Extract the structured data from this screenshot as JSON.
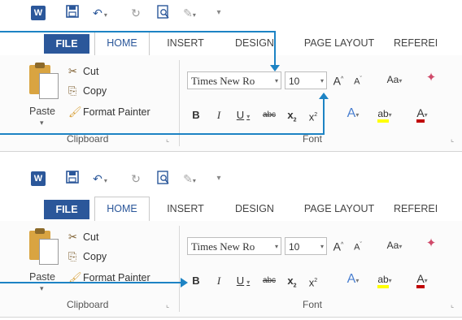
{
  "panels": [
    {
      "qat": {
        "redo": "↻",
        "customize": "▾"
      },
      "tabs": {
        "file": "FILE",
        "home": "HOME",
        "insert": "INSERT",
        "design": "DESIGN",
        "page_layout": "PAGE LAYOUT",
        "references": "REFEREI"
      },
      "clipboard": {
        "paste": "Paste",
        "cut": "Cut",
        "copy": "Copy",
        "format_painter": "Format Painter",
        "group_label": "Clipboard"
      },
      "font": {
        "name": "Times New Ro",
        "size": "10",
        "group_label": "Font"
      }
    },
    {
      "qat": {
        "redo": "↻",
        "customize": "▾"
      },
      "tabs": {
        "file": "FILE",
        "home": "HOME",
        "insert": "INSERT",
        "design": "DESIGN",
        "page_layout": "PAGE LAYOUT",
        "references": "REFEREI"
      },
      "clipboard": {
        "paste": "Paste",
        "cut": "Cut",
        "copy": "Copy",
        "format_painter": "Format Painter",
        "group_label": "Clipboard"
      },
      "font": {
        "name": "Times New Ro",
        "size": "10",
        "group_label": "Font"
      }
    }
  ],
  "colors": {
    "accent": "#2b579a",
    "callout_arrow": "#1d83c4",
    "font_color": "#c00000",
    "highlight": "#ffff00"
  }
}
